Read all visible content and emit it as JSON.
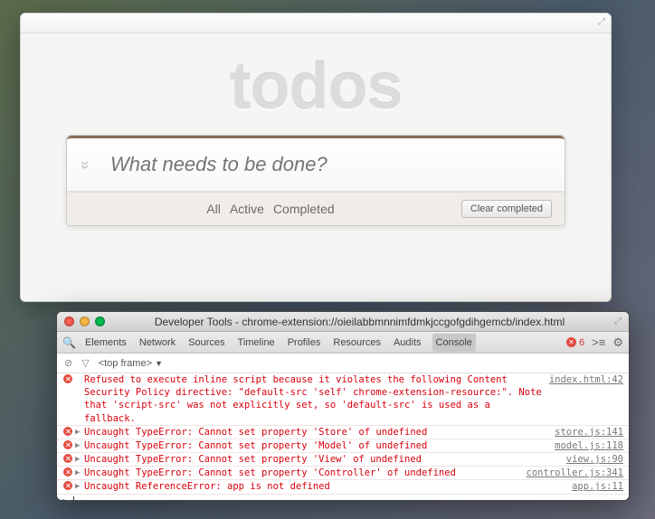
{
  "app": {
    "title": "todos",
    "input_placeholder": "What needs to be done?",
    "toggle_all_glyph": "»",
    "filters": {
      "all": "All",
      "active": "Active",
      "completed": "Completed"
    },
    "clear_label": "Clear completed"
  },
  "devtools": {
    "title": "Developer Tools - chrome-extension://oieilabbmnnimfdmkjccgofgdihgemcb/index.html",
    "tabs": {
      "elements": "Elements",
      "network": "Network",
      "sources": "Sources",
      "timeline": "Timeline",
      "profiles": "Profiles",
      "resources": "Resources",
      "audits": "Audits",
      "console": "Console"
    },
    "error_count": "6",
    "frame": "<top frame>",
    "errors": [
      {
        "expandable": false,
        "msg": "Refused to execute inline script because it violates the following Content Security Policy directive: \"default-src 'self' chrome-extension-resource:\". Note that 'script-src' was not explicitly set, so 'default-src' is used as a fallback.",
        "src": "index.html:42"
      },
      {
        "expandable": true,
        "msg": "Uncaught TypeError: Cannot set property 'Store' of undefined",
        "src": "store.js:141"
      },
      {
        "expandable": true,
        "msg": "Uncaught TypeError: Cannot set property 'Model' of undefined",
        "src": "model.js:118"
      },
      {
        "expandable": true,
        "msg": "Uncaught TypeError: Cannot set property 'View' of undefined",
        "src": "view.js:90"
      },
      {
        "expandable": true,
        "msg": "Uncaught TypeError: Cannot set property 'Controller' of undefined",
        "src": "controller.js:341"
      },
      {
        "expandable": true,
        "msg": "Uncaught ReferenceError: app is not defined",
        "src": "app.js:11"
      }
    ]
  }
}
